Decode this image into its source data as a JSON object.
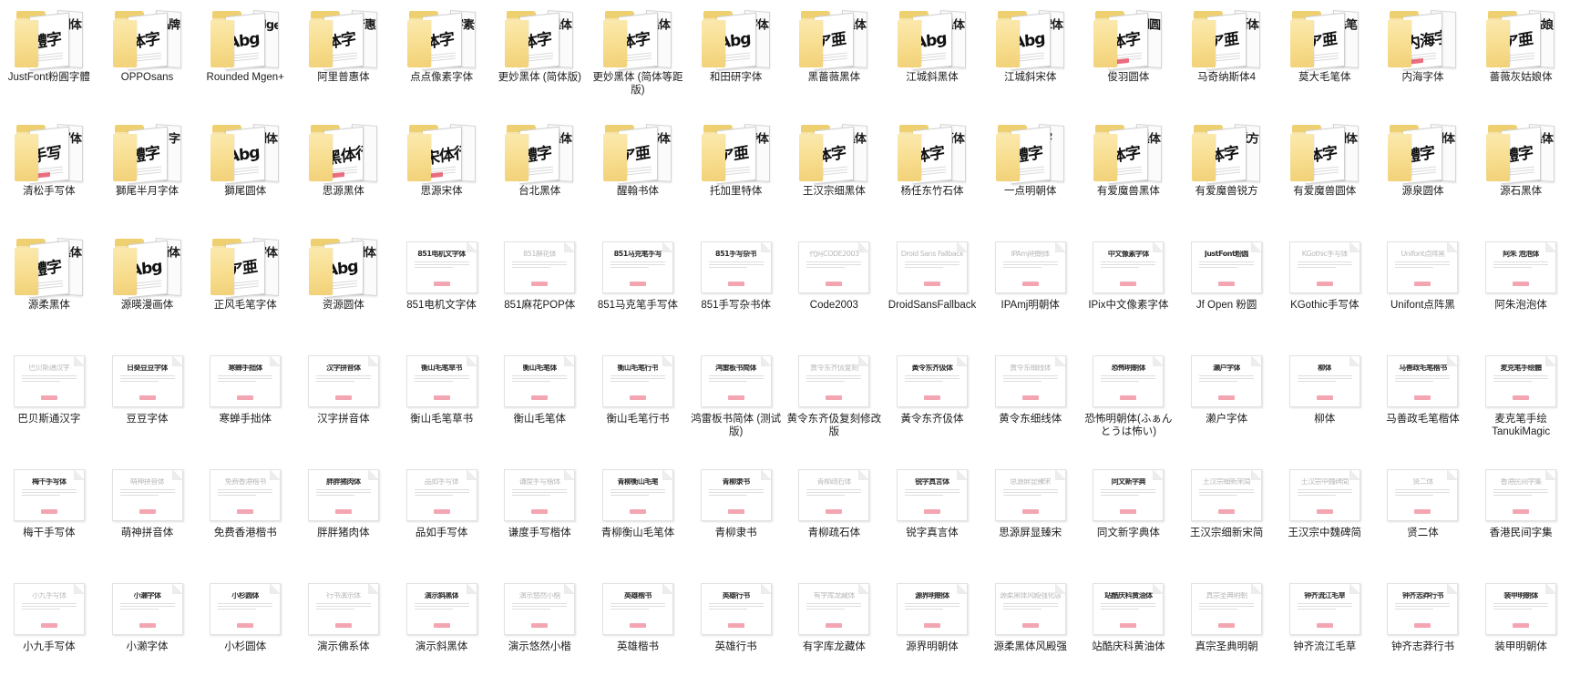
{
  "window": {
    "title": "Fonts",
    "view_mode": "Large icons"
  },
  "colors": {
    "folder_yellow": "#f2d178",
    "folder_light": "#fbf0cf",
    "card_border": "#e2e2e2",
    "stamp_red": "#e8556b",
    "text": "#1c1c1c",
    "background": "#ffffff"
  },
  "grid": {
    "columns": 16,
    "rows": 6,
    "items": [
      {
        "label": "JustFont粉圓字體",
        "type": "folder",
        "glyphA": "體字",
        "glyphB": "圓体"
      },
      {
        "label": "OPPOsans",
        "type": "folder",
        "glyphA": "体字",
        "glyphB": "品牌"
      },
      {
        "label": "Rounded Mgen+",
        "type": "folder",
        "glyphA": "Abg",
        "glyphB": "Mge"
      },
      {
        "label": "阿里普惠体",
        "type": "folder",
        "glyphA": "体字",
        "glyphB": "普惠"
      },
      {
        "label": "点点像素字体",
        "type": "folder",
        "glyphA": "体字",
        "glyphB": "字素"
      },
      {
        "label": "更妙黑体 (简体版)",
        "type": "folder",
        "glyphA": "体字",
        "glyphB": "黑体"
      },
      {
        "label": "更妙黑体 (简体等距版)",
        "type": "folder",
        "glyphA": "体字",
        "glyphB": "黑体"
      },
      {
        "label": "和田研字体",
        "type": "folder",
        "glyphA": "Abg",
        "glyphB": "字体"
      },
      {
        "label": "黑薔薇黑体",
        "type": "folder",
        "glyphA": "ア亜",
        "glyphB": "黑体"
      },
      {
        "label": "江城斜黑体",
        "type": "folder",
        "glyphA": "Abg",
        "glyphB": "黑体"
      },
      {
        "label": "江城斜宋体",
        "type": "folder",
        "glyphA": "Abg",
        "glyphB": "宋体"
      },
      {
        "label": "俊羽圆体",
        "type": "folder",
        "glyphA": "体字",
        "glyphB": "羽圆",
        "stamp": true
      },
      {
        "label": "马奇纳斯体4",
        "type": "folder",
        "glyphA": "ア亜",
        "glyphB": "斯体"
      },
      {
        "label": "莫大毛笔体",
        "type": "folder",
        "glyphA": "ア亜",
        "glyphB": "毛笔"
      },
      {
        "label": "内海字体",
        "type": "folder",
        "glyphA": "内海字体",
        "glyphB": "",
        "stamp": true
      },
      {
        "label": "薔薇灰姑娘体",
        "type": "folder",
        "glyphA": "ア亜",
        "glyphB": "姑娘"
      },
      {
        "label": "清松手写体",
        "type": "folder",
        "glyphA": "手写",
        "glyphB": "写体",
        "stamp": true
      },
      {
        "label": "獅尾半月字体",
        "type": "folder",
        "glyphA": "體字",
        "glyphB": "月字"
      },
      {
        "label": "獅尾圆体",
        "type": "folder",
        "glyphA": "Abg",
        "glyphB": "圆体"
      },
      {
        "label": "思源黑体",
        "type": "folder",
        "glyphA": "黑体行高修正",
        "glyphB": "",
        "stamp": true
      },
      {
        "label": "思源宋体",
        "type": "folder",
        "glyphA": "宋体行高修正",
        "glyphB": "",
        "stamp": true
      },
      {
        "label": "台北黑体",
        "type": "folder",
        "glyphA": "體字",
        "glyphB": "黑体"
      },
      {
        "label": "醒翰书体",
        "type": "folder",
        "glyphA": "ア亜",
        "glyphB": "书体"
      },
      {
        "label": "托加里特体",
        "type": "folder",
        "glyphA": "ア亜",
        "glyphB": "特体"
      },
      {
        "label": "王汉宗细黑体",
        "type": "folder",
        "glyphA": "体字",
        "glyphB": "黑体"
      },
      {
        "label": "杨任东竹石体",
        "type": "folder",
        "glyphA": "体字",
        "glyphB": "石体"
      },
      {
        "label": "一点明朝体",
        "type": "folder",
        "glyphA": "體字",
        "glyphB": "字"
      },
      {
        "label": "有爱魔兽黑体",
        "type": "folder",
        "glyphA": "体字",
        "glyphB": "黑体"
      },
      {
        "label": "有爱魔兽锐方",
        "type": "folder",
        "glyphA": "体字",
        "glyphB": "锐方"
      },
      {
        "label": "有爱魔兽圆体",
        "type": "folder",
        "glyphA": "体字",
        "glyphB": "圆体"
      },
      {
        "label": "源泉圆体",
        "type": "folder",
        "glyphA": "體字",
        "glyphB": "圆体"
      },
      {
        "label": "源石黑体",
        "type": "folder",
        "glyphA": "體字",
        "glyphB": "黑体"
      },
      {
        "label": "源柔黑体",
        "type": "folder",
        "glyphA": "體字",
        "glyphB": "黑体"
      },
      {
        "label": "源暎漫画体",
        "type": "folder",
        "glyphA": "Abg",
        "glyphB": "画体"
      },
      {
        "label": "正风毛笔字体",
        "type": "folder",
        "glyphA": "ア亜",
        "glyphB": "字体"
      },
      {
        "label": "资源圆体",
        "type": "folder",
        "glyphA": "Abg",
        "glyphB": "圆体"
      },
      {
        "label": "851电机文字体",
        "type": "file",
        "preview": "851电机文字体"
      },
      {
        "label": "851麻花POP体",
        "type": "file",
        "preview": "851麻花体",
        "faint": true
      },
      {
        "label": "851马克笔手写体",
        "type": "file",
        "preview": "851马克笔手写"
      },
      {
        "label": "851手写杂书体",
        "type": "file",
        "preview": "851手写杂书"
      },
      {
        "label": "Code2003",
        "type": "file",
        "preview": "代码CODE2003",
        "faint": true
      },
      {
        "label": "DroidSansFallback",
        "type": "file",
        "preview": "Droid Sans Fallback",
        "faint": true
      },
      {
        "label": "IPAmj明朝体",
        "type": "file",
        "preview": "IPAmj明朝体",
        "faint": true
      },
      {
        "label": "IPix中文像素字体",
        "type": "file",
        "preview": "中文像素字体"
      },
      {
        "label": "Jf Open 粉圆",
        "type": "file",
        "preview": "JustFont粉圆"
      },
      {
        "label": "KGothic手写体",
        "type": "file",
        "preview": "KGothic手写体",
        "faint": true
      },
      {
        "label": "Unifont点阵黑",
        "type": "file",
        "preview": "Unifont点阵黑",
        "faint": true
      },
      {
        "label": "阿朱泡泡体",
        "type": "file",
        "preview": "阿朱 泡泡体"
      },
      {
        "label": "巴贝斯通汉字",
        "type": "file",
        "preview": "巴贝斯通汉字",
        "faint": true
      },
      {
        "label": "豆豆字体",
        "type": "file",
        "preview": "日葵豆豆字体"
      },
      {
        "label": "寒蝉手拙体",
        "type": "file",
        "preview": "寒蝉手拙体"
      },
      {
        "label": "汉字拼音体",
        "type": "file",
        "preview": "汉字拼音体"
      },
      {
        "label": "衡山毛笔草书",
        "type": "file",
        "preview": "衡山毛笔草书"
      },
      {
        "label": "衡山毛笔体",
        "type": "file",
        "preview": "衡山毛笔体"
      },
      {
        "label": "衡山毛笔行书",
        "type": "file",
        "preview": "衡山毛笔行书"
      },
      {
        "label": "鸿雷板书简体 (测试版)",
        "type": "file",
        "preview": "鸿雷板书简体"
      },
      {
        "label": "黄令东齐伋复刻修改版",
        "type": "file",
        "preview": "黄令东齐伋复刻",
        "faint": true
      },
      {
        "label": "黃令东齐伋体",
        "type": "file",
        "preview": "黃令东齐伋体"
      },
      {
        "label": "黄令东细线体",
        "type": "file",
        "preview": "黄令东细线体",
        "faint": true
      },
      {
        "label": "恐怖明朝体(ふぁんとうは怖い)",
        "type": "file",
        "preview": "恐怖明朝体"
      },
      {
        "label": "濑户字体",
        "type": "file",
        "preview": "濑户字体"
      },
      {
        "label": "柳体",
        "type": "file",
        "preview": "柳体"
      },
      {
        "label": "马善政毛笔楷体",
        "type": "file",
        "preview": "马善政毛笔楷书"
      },
      {
        "label": "麦克笔手绘TanukiMagic",
        "type": "file",
        "preview": "麦克笔手绘體"
      },
      {
        "label": "梅干手写体",
        "type": "file",
        "preview": "梅干手写体"
      },
      {
        "label": "萌神拼音体",
        "type": "file",
        "preview": "萌神拼音体",
        "faint": true
      },
      {
        "label": "免费香港楷书",
        "type": "file",
        "preview": "免费香港楷书",
        "faint": true
      },
      {
        "label": "胖胖猪肉体",
        "type": "file",
        "preview": "胖胖猪肉体"
      },
      {
        "label": "品如手写体",
        "type": "file",
        "preview": "品如手写体",
        "faint": true
      },
      {
        "label": "谦度手写楷体",
        "type": "file",
        "preview": "谦度手写楷体",
        "faint": true
      },
      {
        "label": "青柳衡山毛笔体",
        "type": "file",
        "preview": "青柳衡山毛笔"
      },
      {
        "label": "青柳隶书",
        "type": "file",
        "preview": "青柳隶书"
      },
      {
        "label": "青柳疏石体",
        "type": "file",
        "preview": "青柳疏石体",
        "faint": true
      },
      {
        "label": "锐字真言体",
        "type": "file",
        "preview": "锐字真言体"
      },
      {
        "label": "思源屏显臻宋",
        "type": "file",
        "preview": "思源屏显臻宋",
        "faint": true
      },
      {
        "label": "同文新字典体",
        "type": "file",
        "preview": "同文新字典"
      },
      {
        "label": "王汉宗细新宋简",
        "type": "file",
        "preview": "王汉宗细新宋简",
        "faint": true
      },
      {
        "label": "王汉宗中魏碑简",
        "type": "file",
        "preview": "王汉宗中魏碑简",
        "faint": true
      },
      {
        "label": "贤二体",
        "type": "file",
        "preview": "贤二体",
        "faint": true
      },
      {
        "label": "香港民间字集",
        "type": "file",
        "preview": "香港民间字集",
        "faint": true
      },
      {
        "label": "小九手写体",
        "type": "file",
        "preview": "小九手写体",
        "faint": true
      },
      {
        "label": "小濑字体",
        "type": "file",
        "preview": "小濑字体"
      },
      {
        "label": "小杉圆体",
        "type": "file",
        "preview": "小杉圆体"
      },
      {
        "label": "演示佛系体",
        "type": "file",
        "preview": "行书演示体",
        "faint": true
      },
      {
        "label": "演示斜黑体",
        "type": "file",
        "preview": "演示斜黑体"
      },
      {
        "label": "演示悠然小楷",
        "type": "file",
        "preview": "演示悠然小楷",
        "faint": true
      },
      {
        "label": "英雄楷书",
        "type": "file",
        "preview": "英雄楷书"
      },
      {
        "label": "英雄行书",
        "type": "file",
        "preview": "英雄行书"
      },
      {
        "label": "有字库龙藏体",
        "type": "file",
        "preview": "有字库龙藏体",
        "faint": true
      },
      {
        "label": "源界明朝体",
        "type": "file",
        "preview": "源界明朝体"
      },
      {
        "label": "源柔黑体风殿强",
        "type": "file",
        "preview": "源柔黑体风殿强化版",
        "faint": true
      },
      {
        "label": "站酷庆科黄油体",
        "type": "file",
        "preview": "站酷庆科黄油体"
      },
      {
        "label": "真宗圣典明朝",
        "type": "file",
        "preview": "真宗圣典明朝",
        "faint": true
      },
      {
        "label": "钟齐流江毛草",
        "type": "file",
        "preview": "钟齐流江毛草"
      },
      {
        "label": "钟齐志莽行书",
        "type": "file",
        "preview": "钟齐志莽行书"
      },
      {
        "label": "装甲明朝体",
        "type": "file",
        "preview": "装甲明朝体"
      }
    ]
  }
}
